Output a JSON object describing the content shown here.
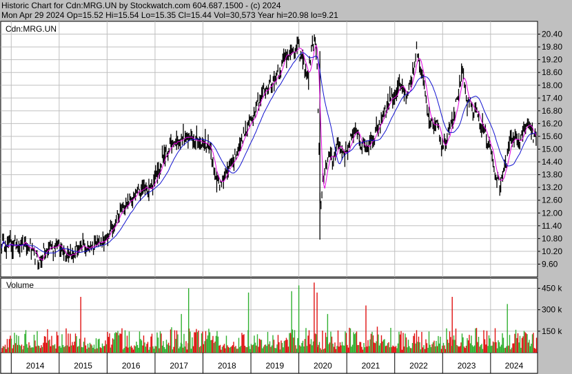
{
  "header": {
    "line1": "Historic Chart for Cdn:MRG.UN by Stockwatch.com 604.687.1500 - (c) 2024",
    "line2": "Mon Apr 29 2024   Op=15.52  Hi=15.54  Lo=15.35  Cl=15.44  Vol=30,573  Year hi=20.98  lo=9.21"
  },
  "chart_data": [
    {
      "type": "candlestick",
      "symbol_label": "Cdn:MRG.UN",
      "y_ticks": [
        "20.40",
        "19.80",
        "19.20",
        "18.60",
        "18.00",
        "17.40",
        "16.80",
        "16.20",
        "15.60",
        "15.00",
        "14.40",
        "13.80",
        "13.20",
        "12.60",
        "12.00",
        "11.40",
        "10.80",
        "10.20",
        "9.60"
      ],
      "ylim": [
        9.0,
        21.0
      ],
      "x_ticks": [
        "2014",
        "2015",
        "2016",
        "2017",
        "2018",
        "2019",
        "2020",
        "2021",
        "2022",
        "2023",
        "2024"
      ],
      "grid": true,
      "moving_averages": [
        "magenta",
        "blue"
      ],
      "close_series": [
        {
          "x": 2013.8,
          "y": 10.55
        },
        {
          "x": 2014.0,
          "y": 10.45
        },
        {
          "x": 2014.2,
          "y": 10.6
        },
        {
          "x": 2014.45,
          "y": 10.2
        },
        {
          "x": 2014.55,
          "y": 9.7
        },
        {
          "x": 2014.75,
          "y": 10.3
        },
        {
          "x": 2014.95,
          "y": 10.55
        },
        {
          "x": 2015.1,
          "y": 10.2
        },
        {
          "x": 2015.25,
          "y": 10.05
        },
        {
          "x": 2015.45,
          "y": 10.35
        },
        {
          "x": 2015.65,
          "y": 10.4
        },
        {
          "x": 2015.8,
          "y": 10.7
        },
        {
          "x": 2015.95,
          "y": 10.65
        },
        {
          "x": 2016.1,
          "y": 11.3
        },
        {
          "x": 2016.25,
          "y": 12.0
        },
        {
          "x": 2016.45,
          "y": 12.5
        },
        {
          "x": 2016.6,
          "y": 12.85
        },
        {
          "x": 2016.75,
          "y": 13.1
        },
        {
          "x": 2016.95,
          "y": 13.3
        },
        {
          "x": 2017.1,
          "y": 14.3
        },
        {
          "x": 2017.3,
          "y": 15.1
        },
        {
          "x": 2017.5,
          "y": 15.4
        },
        {
          "x": 2017.7,
          "y": 15.55
        },
        {
          "x": 2017.9,
          "y": 15.3
        },
        {
          "x": 2018.05,
          "y": 15.35
        },
        {
          "x": 2018.15,
          "y": 15.0
        },
        {
          "x": 2018.25,
          "y": 13.8
        },
        {
          "x": 2018.35,
          "y": 13.35
        },
        {
          "x": 2018.5,
          "y": 14.0
        },
        {
          "x": 2018.7,
          "y": 14.8
        },
        {
          "x": 2018.9,
          "y": 15.9
        },
        {
          "x": 2019.0,
          "y": 16.3
        },
        {
          "x": 2019.15,
          "y": 17.3
        },
        {
          "x": 2019.35,
          "y": 17.9
        },
        {
          "x": 2019.55,
          "y": 18.5
        },
        {
          "x": 2019.75,
          "y": 19.6
        },
        {
          "x": 2019.9,
          "y": 19.5
        },
        {
          "x": 2020.0,
          "y": 19.8
        },
        {
          "x": 2020.1,
          "y": 19.0
        },
        {
          "x": 2020.2,
          "y": 18.4
        },
        {
          "x": 2020.25,
          "y": 19.3
        },
        {
          "x": 2020.32,
          "y": 20.4
        },
        {
          "x": 2020.38,
          "y": 19.0
        },
        {
          "x": 2020.42,
          "y": 15.0
        },
        {
          "x": 2020.45,
          "y": 12.0
        },
        {
          "x": 2020.5,
          "y": 13.2
        },
        {
          "x": 2020.6,
          "y": 14.8
        },
        {
          "x": 2020.7,
          "y": 14.4
        },
        {
          "x": 2020.8,
          "y": 15.3
        },
        {
          "x": 2020.95,
          "y": 14.7
        },
        {
          "x": 2021.1,
          "y": 15.5
        },
        {
          "x": 2021.2,
          "y": 15.9
        },
        {
          "x": 2021.35,
          "y": 15.0
        },
        {
          "x": 2021.5,
          "y": 15.4
        },
        {
          "x": 2021.7,
          "y": 16.3
        },
        {
          "x": 2021.85,
          "y": 17.2
        },
        {
          "x": 2022.0,
          "y": 17.6
        },
        {
          "x": 2022.1,
          "y": 18.0
        },
        {
          "x": 2022.25,
          "y": 17.4
        },
        {
          "x": 2022.35,
          "y": 18.1
        },
        {
          "x": 2022.45,
          "y": 19.6
        },
        {
          "x": 2022.55,
          "y": 18.6
        },
        {
          "x": 2022.65,
          "y": 17.5
        },
        {
          "x": 2022.75,
          "y": 16.1
        },
        {
          "x": 2022.9,
          "y": 16.3
        },
        {
          "x": 2023.0,
          "y": 14.9
        },
        {
          "x": 2023.1,
          "y": 15.8
        },
        {
          "x": 2023.2,
          "y": 16.4
        },
        {
          "x": 2023.3,
          "y": 17.3
        },
        {
          "x": 2023.4,
          "y": 18.6
        },
        {
          "x": 2023.5,
          "y": 17.3
        },
        {
          "x": 2023.6,
          "y": 16.9
        },
        {
          "x": 2023.7,
          "y": 16.8
        },
        {
          "x": 2023.8,
          "y": 16.1
        },
        {
          "x": 2023.9,
          "y": 15.7
        },
        {
          "x": 2024.0,
          "y": 15.1
        },
        {
          "x": 2024.1,
          "y": 13.7
        },
        {
          "x": 2024.2,
          "y": 13.3
        },
        {
          "x": 2024.3,
          "y": 14.3
        },
        {
          "x": 2024.4,
          "y": 15.2
        },
        {
          "x": 2024.5,
          "y": 15.6
        },
        {
          "x": 2024.6,
          "y": 15.3
        },
        {
          "x": 2024.75,
          "y": 16.2
        },
        {
          "x": 2024.85,
          "y": 15.8
        },
        {
          "x": 2024.95,
          "y": 15.44
        }
      ],
      "volume": {
        "label": "Volume",
        "y_ticks": [
          "450 k",
          "300 k",
          "150 k"
        ],
        "ylim": [
          0,
          520000
        ],
        "spikes": [
          {
            "x": 2015.45,
            "v": 390000,
            "c": "red"
          },
          {
            "x": 2017.7,
            "v": 450000,
            "c": "green"
          },
          {
            "x": 2017.55,
            "v": 270000,
            "c": "green"
          },
          {
            "x": 2018.95,
            "v": 420000,
            "c": "green"
          },
          {
            "x": 2019.85,
            "v": 430000,
            "c": "green"
          },
          {
            "x": 2020.0,
            "v": 470000,
            "c": "green"
          },
          {
            "x": 2020.32,
            "v": 490000,
            "c": "red"
          },
          {
            "x": 2020.38,
            "v": 420000,
            "c": "red"
          },
          {
            "x": 2020.6,
            "v": 270000,
            "c": "green"
          },
          {
            "x": 2021.4,
            "v": 330000,
            "c": "red"
          },
          {
            "x": 2023.2,
            "v": 390000,
            "c": "red"
          },
          {
            "x": 2024.35,
            "v": 340000,
            "c": "green"
          }
        ]
      }
    }
  ]
}
